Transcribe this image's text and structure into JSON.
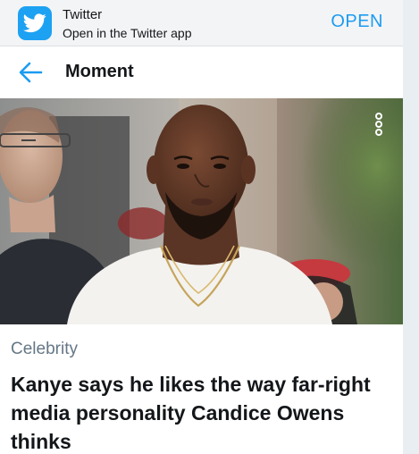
{
  "banner": {
    "app_name": "Twitter",
    "subtitle": "Open in the Twitter app",
    "open_label": "OPEN",
    "icon": "twitter-bird-icon"
  },
  "header": {
    "title": "Moment",
    "back_icon": "back-arrow-icon"
  },
  "hero": {
    "more_icon": "more-options-icon"
  },
  "article": {
    "category": "Celebrity",
    "headline": "Kanye says he likes the way far-right media personality Candice Owens thinks"
  },
  "colors": {
    "accent": "#1d9bf0",
    "banner_bg": "#f3f4f6",
    "text_primary": "#14171a",
    "text_secondary": "#657786"
  }
}
